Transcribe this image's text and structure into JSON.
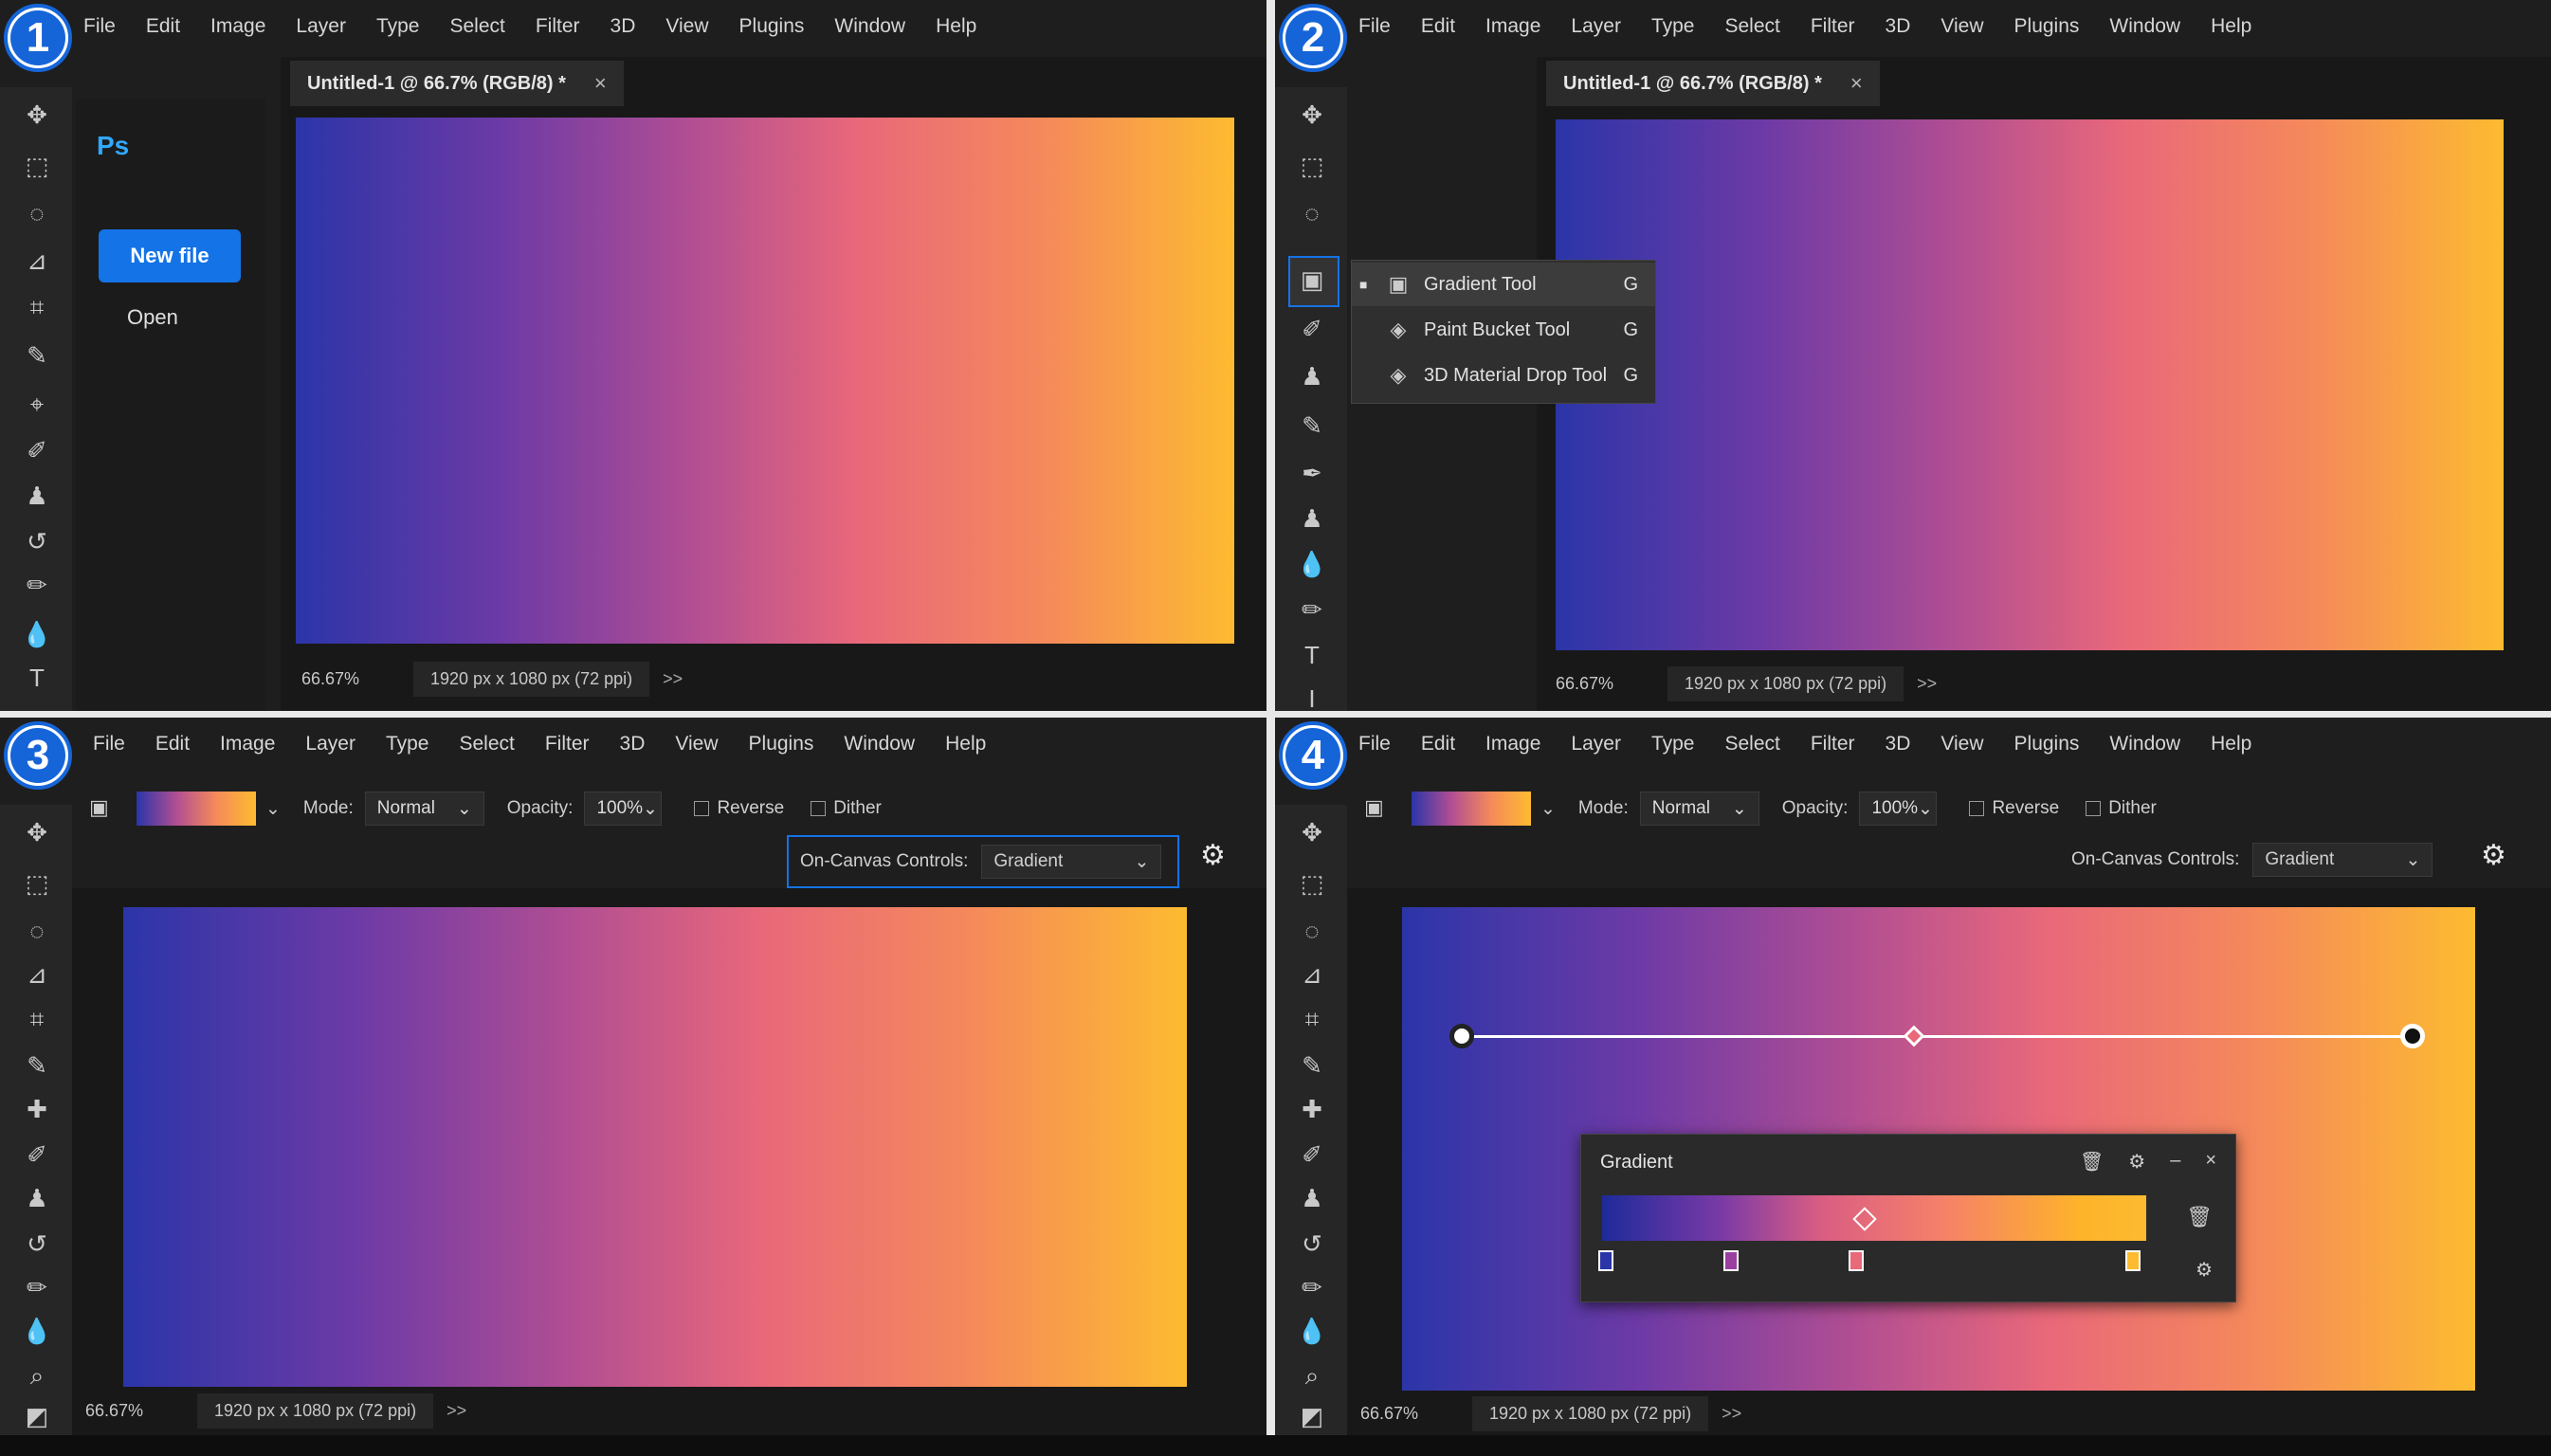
{
  "steps": [
    "1",
    "2",
    "3",
    "4"
  ],
  "menu": [
    "File",
    "Edit",
    "Image",
    "Layer",
    "Type",
    "Select",
    "Filter",
    "3D",
    "View",
    "Plugins",
    "Window",
    "Help"
  ],
  "document": {
    "tab_title": "Untitled-1 @ 66.7% (RGB/8) *",
    "zoom": "66.67%",
    "dimensions": "1920 px x 1080 px (72 ppi)",
    "more": ">>"
  },
  "home": {
    "logo": "Ps",
    "new_file": "New file",
    "open": "Open"
  },
  "flyout": {
    "items": [
      {
        "label": "Gradient Tool",
        "key": "G"
      },
      {
        "label": "Paint Bucket Tool",
        "key": "G"
      },
      {
        "label": "3D Material Drop Tool",
        "key": "G"
      }
    ]
  },
  "options": {
    "mode_label": "Mode:",
    "mode_value": "Normal",
    "opacity_label": "Opacity:",
    "opacity_value": "100%",
    "reverse": "Reverse",
    "dither": "Dither",
    "occ_label": "On-Canvas Controls:",
    "occ_value": "Gradient"
  },
  "gradient_panel": {
    "title": "Gradient"
  },
  "colors": {
    "accent": "#1473e6",
    "gradient_start": "#2b35a8",
    "gradient_mid": "#e9687a",
    "gradient_end": "#fdbb30"
  }
}
